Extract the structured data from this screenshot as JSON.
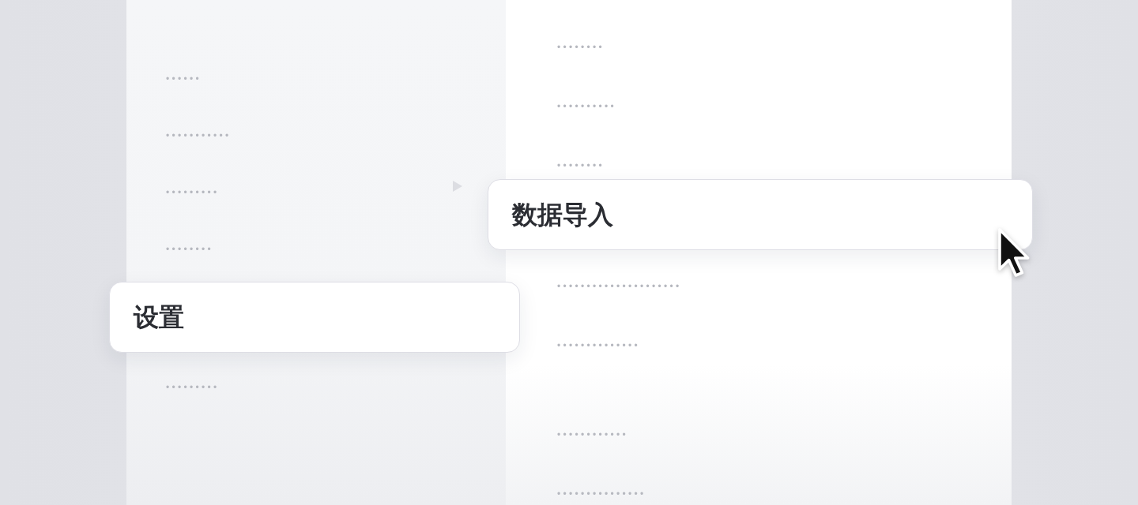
{
  "sidebar": {
    "items": [
      {
        "label": "••••••",
        "selected": false,
        "submenu": false
      },
      {
        "label": "•••••••••••",
        "selected": false,
        "submenu": false
      },
      {
        "label": "•••••••••",
        "selected": false,
        "submenu": true
      },
      {
        "label": "••••••••",
        "selected": false,
        "submenu": false
      },
      {
        "label": "设置",
        "selected": true,
        "submenu": false
      },
      {
        "label": "•••••••••",
        "selected": false,
        "submenu": false
      }
    ]
  },
  "content": {
    "groups": [
      {
        "items": [
          {
            "label": "••••••••",
            "selected": false,
            "hovered": false
          },
          {
            "label": "••••••••••",
            "selected": false,
            "hovered": false
          },
          {
            "label": "••••••••",
            "selected": false,
            "hovered": false
          },
          {
            "label": "数据导入",
            "selected": true,
            "hovered": true
          },
          {
            "label": "•••••••••••••••••••••",
            "selected": false,
            "hovered": false
          },
          {
            "label": "••••••••••••••",
            "selected": false,
            "hovered": false
          }
        ]
      },
      {
        "items": [
          {
            "label": "••••••••••••",
            "selected": false,
            "hovered": false
          },
          {
            "label": "•••••••••••••••",
            "selected": false,
            "hovered": false
          }
        ]
      }
    ]
  }
}
